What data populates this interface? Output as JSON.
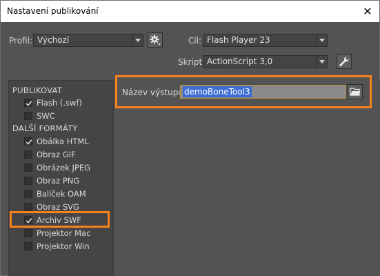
{
  "window": {
    "title": "Nastavení publikování",
    "close_glyph": "✕"
  },
  "profile": {
    "label": "Profil:",
    "value": "Výchozí",
    "settings_icon": "gear-icon"
  },
  "target": {
    "label": "Cíl:",
    "value": "Flash Player 23"
  },
  "script": {
    "label": "Skript:",
    "value": "ActionScript 3,0",
    "settings_icon": "wrench-icon"
  },
  "sidebar": {
    "publish_header": "PUBLIKOVAT",
    "publish_items": [
      {
        "label": "Flash (.swf)",
        "checked": true
      },
      {
        "label": "SWC",
        "checked": false
      }
    ],
    "other_header": "DALŠÍ FORMÁTY",
    "other_items": [
      {
        "label": "Obálka HTML",
        "checked": true
      },
      {
        "label": "Obraz GIF",
        "checked": false
      },
      {
        "label": "Obrázek JPEG",
        "checked": false
      },
      {
        "label": "Obraz PNG",
        "checked": false
      },
      {
        "label": "Balíček OAM",
        "checked": false
      },
      {
        "label": "Obraz SVG",
        "checked": false
      },
      {
        "label": "Archiv SWF",
        "checked": true
      },
      {
        "label": "Projektor Mac",
        "checked": false
      },
      {
        "label": "Projektor Win",
        "checked": false
      }
    ]
  },
  "output": {
    "label": "Název výstupu:",
    "value": "demoBoneTool3",
    "browse_icon": "folder-icon"
  },
  "colors": {
    "highlight": "#f7821b",
    "selection": "#3d6dd4",
    "panel": "#454545",
    "background": "#535353"
  }
}
